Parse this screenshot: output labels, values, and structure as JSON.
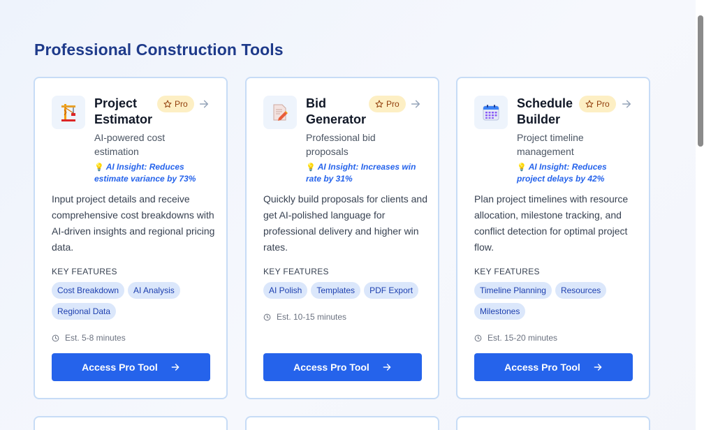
{
  "section": {
    "title": "Professional Construction Tools"
  },
  "badge_label": "Pro",
  "key_features_label": "KEY FEATURES",
  "insight_prefix_icon": "lightbulb-icon",
  "colors": {
    "title": "#1e3a8a",
    "accent": "#2563eb",
    "badge_bg": "#fdefc4",
    "tag_bg": "#dbe7fb",
    "card_border": "#c7dcf6"
  },
  "tools": [
    {
      "icon": "crane-icon",
      "title": "Project Estimator",
      "subtitle": "AI-powered cost estimation",
      "insight": "AI Insight: Reduces estimate variance by 73%",
      "description": "Input project details and receive comprehensive cost breakdowns with AI-driven insights and regional pricing data.",
      "features": [
        "Cost Breakdown",
        "AI Analysis",
        "Regional Data"
      ],
      "estimate": "Est. 5-8 minutes",
      "cta": "Access Pro Tool"
    },
    {
      "icon": "document-pencil-icon",
      "title": "Bid Generator",
      "subtitle": "Professional bid proposals",
      "insight": "AI Insight: Increases win rate by 31%",
      "description": "Quickly build proposals for clients and get AI-polished language for professional delivery and higher win rates.",
      "features": [
        "AI Polish",
        "Templates",
        "PDF Export"
      ],
      "estimate": "Est. 10-15 minutes",
      "cta": "Access Pro Tool"
    },
    {
      "icon": "calendar-icon",
      "title": "Schedule Builder",
      "subtitle": "Project timeline management",
      "insight": "AI Insight: Reduces project delays by 42%",
      "description": "Plan project timelines with resource allocation, milestone tracking, and conflict detection for optimal project flow.",
      "features": [
        "Timeline Planning",
        "Resources",
        "Milestones"
      ],
      "estimate": "Est. 15-20 minutes",
      "cta": "Access Pro Tool"
    }
  ]
}
